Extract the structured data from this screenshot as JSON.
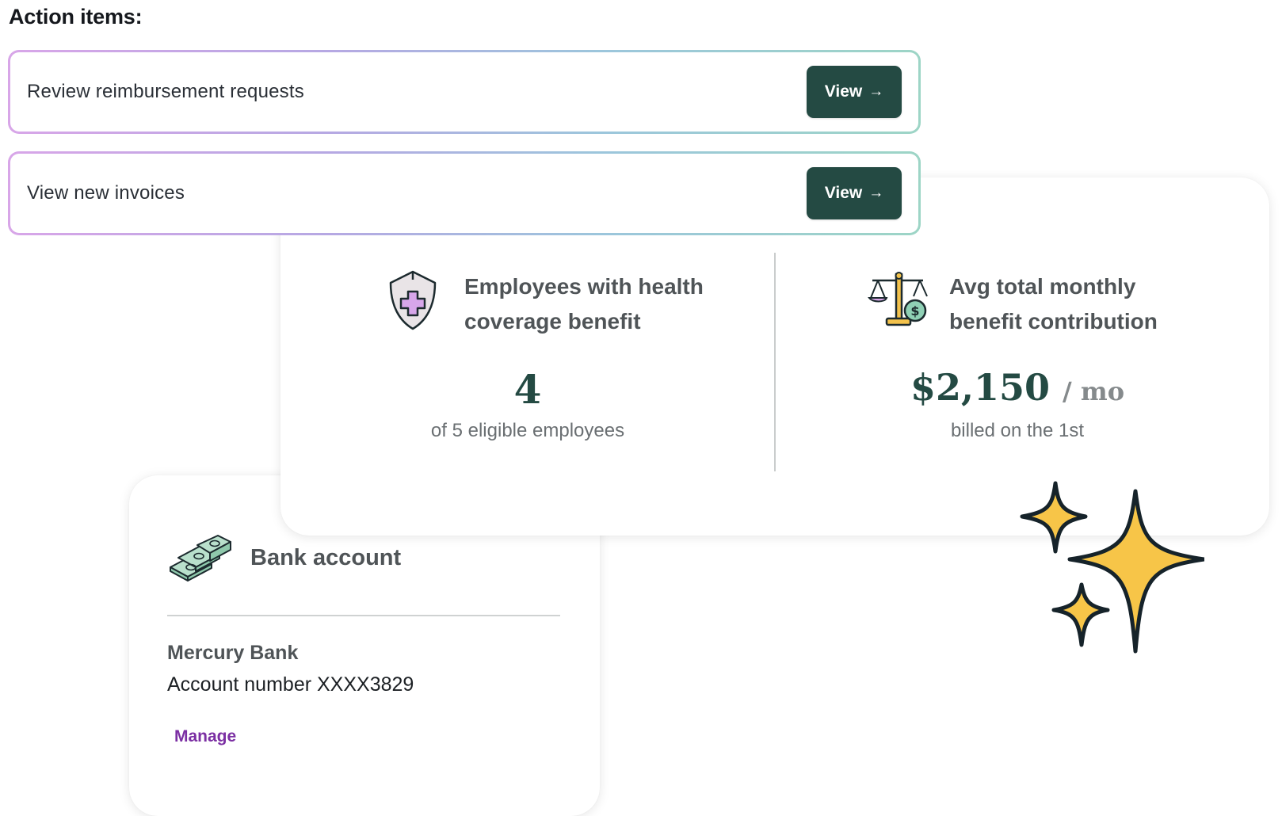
{
  "heading": "Action items:",
  "action_items": [
    {
      "label": "Review reimbursement requests",
      "button": "View",
      "arrow": "→"
    },
    {
      "label": "View new invoices",
      "button": "View",
      "arrow": "→"
    }
  ],
  "benefits": {
    "health": {
      "title_line1": "Employees with health",
      "title_line2": "coverage benefit",
      "value": "4",
      "sub": "of 5 eligible employees",
      "icon": "shield-plus-icon"
    },
    "contribution": {
      "title_line1": "Avg total monthly",
      "title_line2": "benefit contribution",
      "value": "$2,150",
      "unit": "/ mo",
      "sub": "billed on the 1st",
      "icon": "scales-icon"
    }
  },
  "bank": {
    "title": "Bank account",
    "name": "Mercury Bank",
    "account": "Account number XXXX3829",
    "manage": "Manage",
    "icon": "money-stack-icon"
  },
  "colors": {
    "primary": "#244a43",
    "link": "#7b2fa3",
    "sparkle": "#f7c548"
  }
}
